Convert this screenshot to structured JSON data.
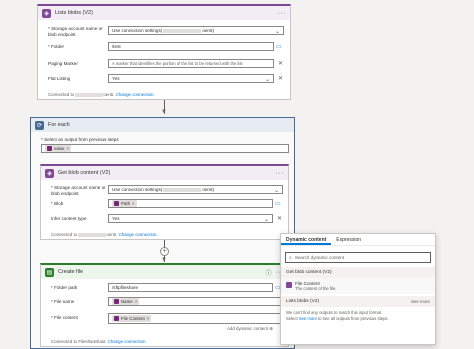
{
  "list_blobs": {
    "title": "Lists blobs (V2)",
    "more": "···",
    "storage_label": "* Storage account name or blob endpoint",
    "storage_value": "Use connection settings(",
    "storage_suffix": "oen6)",
    "folder_label": "* Folder",
    "folder_value": "/test",
    "paging_label": "Paging Marker",
    "paging_placeholder": "A marker that identifies the portion of the list to be returned with the list",
    "flat_label": "Flat Listing",
    "flat_value": "Yes",
    "connected_prefix": "Connected to",
    "connected_suffix": "oen6.",
    "change_connection": "Change connection."
  },
  "for_each": {
    "title": "For each",
    "select_label": "* Select an output from previous steps",
    "token_value": "value",
    "token_x": "×"
  },
  "get_blob": {
    "title": "Get blob content (V2)",
    "more": "···",
    "storage_label": "* Storage account name or blob endpoint",
    "storage_value": "Use connection settings(",
    "storage_suffix": "oen6)",
    "blob_label": "* Blob",
    "blob_token": "Path",
    "blob_x": "×",
    "infer_label": "Infer content type",
    "infer_value": "Yes",
    "connected_prefix": "Connected to",
    "connected_suffix": "oen6.",
    "change_connection": "Change connection."
  },
  "create_file": {
    "title": "Create file",
    "more": "···",
    "folder_label": "* Folder path",
    "folder_value": "/sftpfileshare",
    "name_label": "* File name",
    "name_token": "Name",
    "name_x": "×",
    "content_label": "* File content",
    "content_token": "File Content",
    "content_x": "×",
    "add_dynamic": "Add dynamic content",
    "connected_prefix": "Connected to FileshareEast.",
    "change_connection": "Change connection."
  },
  "dynamic_panel": {
    "tab_dynamic": "Dynamic content",
    "tab_expression": "Expression",
    "search_placeholder": "Search dynamic content",
    "section_get_blob": "Get blob content (V2)",
    "item_title": "File Content",
    "item_desc": "The content of the file.",
    "section_list_blobs": "Lists blobs (V2)",
    "see_more": "See more",
    "note_line1": "We can't find any outputs to match this input format.",
    "note_line2_prefix": "Select",
    "note_link": "See more",
    "note_line2_suffix": "to see all outputs from previous steps."
  },
  "colors": {
    "blob_accent": "#804998",
    "foreach_accent": "#486991",
    "sftp_accent": "#2b7d2b",
    "link": "#0078d4"
  }
}
